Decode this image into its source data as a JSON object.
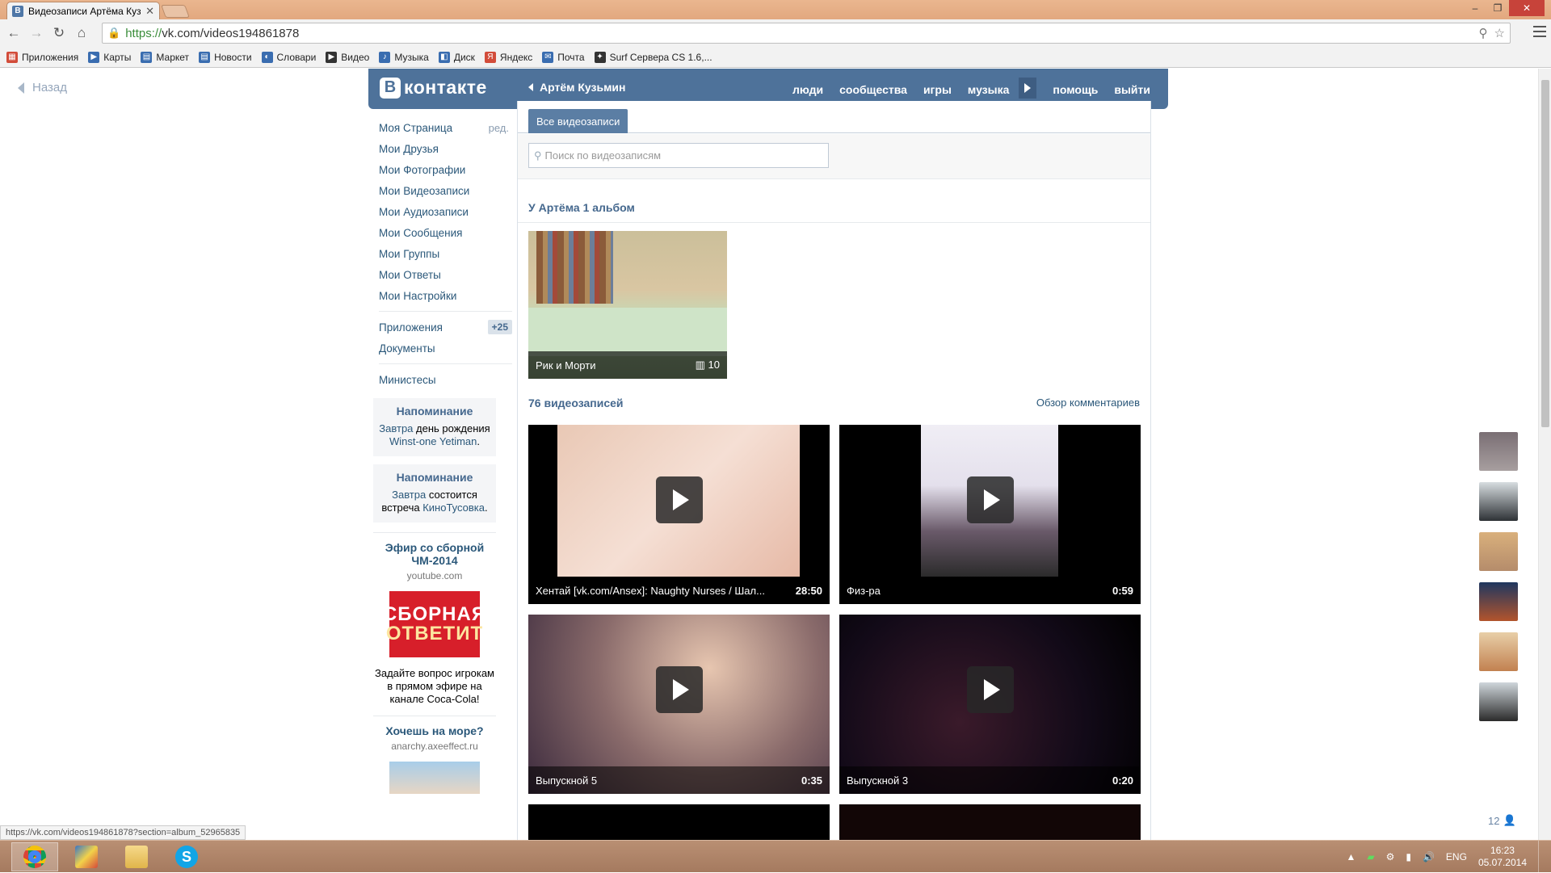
{
  "browser": {
    "tab_title": "Видеозаписи Артёма Кузь",
    "tab_favicon": "В",
    "url_scheme": "https://",
    "url_rest": "vk.com/videos194861878",
    "window_controls": [
      "–",
      "❐",
      "✕"
    ]
  },
  "bookmarks": [
    {
      "label": "Приложения",
      "icon": "apps-grid-icon",
      "color": "#d24c3a"
    },
    {
      "label": "Карты",
      "icon": "maps-icon",
      "color": "#3a6db0"
    },
    {
      "label": "Маркет",
      "icon": "market-icon",
      "color": "#3a6db0"
    },
    {
      "label": "Новости",
      "icon": "news-icon",
      "color": "#3a6db0"
    },
    {
      "label": "Словари",
      "icon": "dictionary-icon",
      "color": "#3a6db0"
    },
    {
      "label": "Видео",
      "icon": "video-icon",
      "color": "#333333"
    },
    {
      "label": "Музыка",
      "icon": "music-icon",
      "color": "#3a6db0"
    },
    {
      "label": "Диск",
      "icon": "disk-icon",
      "color": "#3a6db0"
    },
    {
      "label": "Яндекс",
      "icon": "yandex-icon",
      "color": "#d24c3a"
    },
    {
      "label": "Почта",
      "icon": "mail-icon",
      "color": "#3a6db0"
    },
    {
      "label": "Surf Сервера CS 1.6,...",
      "icon": "cs-icon",
      "color": "#333333"
    }
  ],
  "back_label": "Назад",
  "header": {
    "logo_letter": "В",
    "logo_text": "контакте",
    "user_name": "Артём Кузьмин",
    "nav": [
      "люди",
      "сообщества",
      "игры",
      "музыка",
      "помощь",
      "выйти"
    ]
  },
  "left_menu": {
    "items": [
      "Моя Страница",
      "Мои Друзья",
      "Мои Фотографии",
      "Мои Видеозаписи",
      "Мои Аудиозаписи",
      "Мои Сообщения",
      "Мои Группы",
      "Мои Ответы",
      "Мои Настройки"
    ],
    "edit_label": "ред.",
    "apps_label": "Приложения",
    "apps_badge": "+25",
    "docs_label": "Документы",
    "ministry_label": "Министесы"
  },
  "reminders": [
    {
      "title": "Напоминание",
      "link1": "Завтра",
      "text": "день рождения",
      "link2": "Winst-one Yetiman",
      "end": "."
    },
    {
      "title": "Напоминание",
      "link1": "Завтра",
      "text": "состоится встреча",
      "link2": "КиноТусовка",
      "end": "."
    }
  ],
  "ads": [
    {
      "title": "Эфир со сборной ЧМ-2014",
      "domain": "youtube.com",
      "image_line1": "СБОРНАЯ",
      "image_line2": "ОТВЕТИТ",
      "text": "Задайте вопрос игрокам в прямом эфире на канале Coca-Cola!"
    },
    {
      "title": "Хочешь на море?",
      "domain": "anarchy.axeeffect.ru"
    }
  ],
  "content": {
    "tab_all": "Все видеозаписи",
    "search_placeholder": "Поиск по видеозаписям",
    "albums_heading": "У Артёма 1 альбом",
    "album": {
      "title": "Рик и Морти",
      "count": "10"
    },
    "videos_heading": "76 видеозаписей",
    "comments_link": "Обзор комментариев",
    "videos": [
      {
        "title": "Хентай [vk.com/Ansex]: Naughty Nurses / Шал...",
        "duration": "28:50"
      },
      {
        "title": "Физ-ра",
        "duration": "0:59"
      },
      {
        "title": "Выпускной 5",
        "duration": "0:35"
      },
      {
        "title": "Выпускной 3",
        "duration": "0:20"
      }
    ]
  },
  "friends_count": "12",
  "status_url": "https://vk.com/videos194861878?section=album_52965835",
  "taskbar": {
    "lang": "ENG",
    "time": "16:23",
    "date": "05.07.2014"
  },
  "colors": {
    "vk_blue": "#4e729a",
    "link": "#2b587a",
    "title_bar": "#e2a87f"
  }
}
